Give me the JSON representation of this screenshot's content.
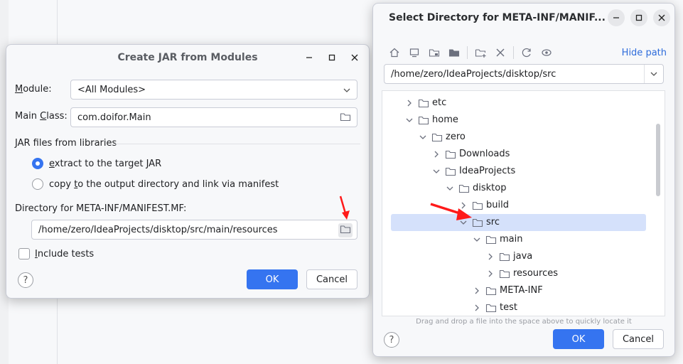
{
  "jar_dialog": {
    "title": "Create JAR from Modules",
    "module_label": "Module:",
    "module_label_mnemonic": "M",
    "module_label_rest": "odule:",
    "module_value": "<All Modules>",
    "main_class_label_pre": "Main ",
    "main_class_label_mnemonic": "C",
    "main_class_label_rest": "lass:",
    "main_class_value": "com.doifor.Main",
    "jar_files_heading": "JAR files from libraries",
    "radio_extract_mnemonic": "e",
    "radio_extract_rest": "xtract to the target JAR",
    "radio_copy_pre": "copy ",
    "radio_copy_mnemonic": "t",
    "radio_copy_rest": "o the output directory and link via manifest",
    "manifest_dir_label": "Directory for META-INF/MANIFEST.MF:",
    "manifest_dir_value": "/home/zero/IdeaProjects/disktop/src/main/resources",
    "include_tests_mnemonic": "I",
    "include_tests_rest": "nclude tests",
    "help": "?",
    "ok": "OK",
    "cancel": "Cancel"
  },
  "select_dialog": {
    "title": "Select Directory for META-INF/MANIF...",
    "hide_path": "Hide path",
    "path_value": "/home/zero/IdeaProjects/disktop/src",
    "tree": [
      {
        "label": "etc",
        "expanded": false,
        "selected": false
      },
      {
        "label": "home",
        "expanded": true,
        "selected": false
      },
      {
        "label": "zero",
        "expanded": true,
        "selected": false
      },
      {
        "label": "Downloads",
        "expanded": false,
        "selected": false
      },
      {
        "label": "IdeaProjects",
        "expanded": true,
        "selected": false
      },
      {
        "label": "disktop",
        "expanded": true,
        "selected": false
      },
      {
        "label": "build",
        "expanded": false,
        "selected": false
      },
      {
        "label": "src",
        "expanded": true,
        "selected": true
      },
      {
        "label": "main",
        "expanded": true,
        "selected": false
      },
      {
        "label": "java",
        "expanded": false,
        "selected": false
      },
      {
        "label": "resources",
        "expanded": false,
        "selected": false
      },
      {
        "label": "META-INF",
        "expanded": false,
        "selected": false
      },
      {
        "label": "test",
        "expanded": false,
        "selected": false
      }
    ],
    "drag_hint": "Drag and drop a file into the space above to quickly locate it",
    "help": "?",
    "ok": "OK",
    "cancel": "Cancel"
  },
  "colors": {
    "accent": "#3574f0",
    "selection": "#d5e1fb",
    "annotation_arrow": "#ff1a1a"
  }
}
